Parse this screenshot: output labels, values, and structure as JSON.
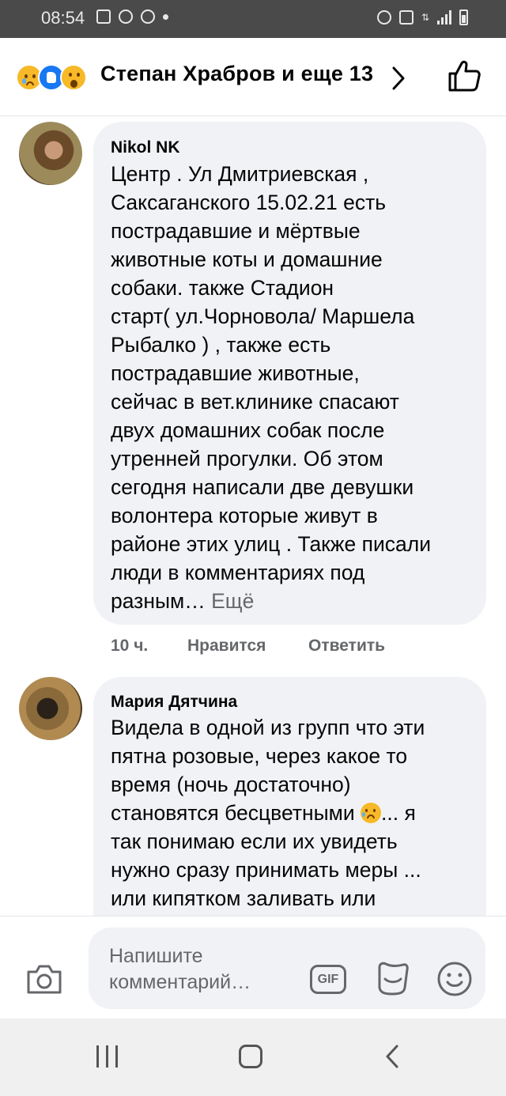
{
  "status_bar": {
    "time": "08:54",
    "icons": [
      "gallery-icon",
      "facebook-icon",
      "viber-icon",
      "dot-icon",
      "alarm-icon",
      "lock-icon",
      "data-icon",
      "signal-icon",
      "battery-icon"
    ]
  },
  "reactions": {
    "emoji_icons": [
      "sad-emoji",
      "like-emoji",
      "wow-emoji"
    ],
    "summary": "Степан Храбров и еще 13"
  },
  "comments": [
    {
      "author": "Nikol NK",
      "lines": [
        "Центр . Ул Дмитриевская ,",
        "Саксаганского 15.02.21  есть",
        "пострадавшие и мёртвые",
        "животные коты и домашние",
        "собаки. также  Стадион",
        "старт( ул.Чорновола/ Маршела",
        "Рыбалко ) , также есть",
        "пострадавшие животные,",
        "сейчас в вет.клинике спасают",
        "двух домашних собак после",
        "утренней прогулки. Об этом",
        "сегодня написали две девушки",
        "волонтера которые живут в",
        "районе этих улиц . Также писали",
        "люди в комментариях под",
        "разным…"
      ],
      "more": "Ещё",
      "time": "10 ч.",
      "like_label": "Нравится",
      "reply_label": "Ответить"
    },
    {
      "author": "Мария Дятчина",
      "lines": [
        "Видела в одной из групп что эти",
        "пятна розовые, через какое то",
        "время (ночь достаточно)",
        "становятся бесцветными",
        "так понимаю если их увидеть",
        "нужно сразу принимать меры ...",
        "или кипятком заливать или"
      ],
      "inline_emoji": "sad-emoji",
      "line4_tail": "... я"
    }
  ],
  "composer": {
    "placeholder_line1": "Напишите",
    "placeholder_line2": "комментарий…",
    "gif_label": "GIF"
  },
  "nav": {
    "icons": [
      "recent-apps-icon",
      "home-icon",
      "back-icon"
    ]
  },
  "colors": {
    "bubble": "#f0f2f5",
    "secondary_text": "#65676b",
    "status_bar": "#4a4a4a",
    "like_blue": "#1877f2",
    "emoji_yellow": "#f7b928"
  }
}
